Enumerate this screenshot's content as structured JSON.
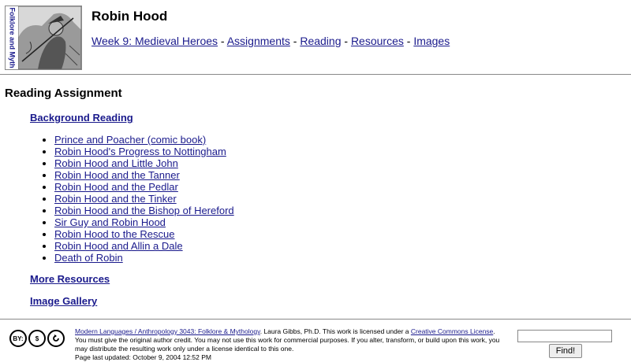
{
  "header": {
    "logo_text": "Folklore and Myth",
    "title": "Robin Hood",
    "nav": [
      {
        "label": "Week 9: Medieval Heroes"
      },
      {
        "label": "Assignments"
      },
      {
        "label": "Reading"
      },
      {
        "label": "Resources"
      },
      {
        "label": "Images"
      }
    ],
    "nav_separator": " - "
  },
  "main": {
    "section_title": "Reading Assignment",
    "background_heading": "Background Reading",
    "readings": [
      "Prince and Poacher (comic book)",
      "Robin Hood's Progress to Nottingham",
      "Robin Hood and Little John",
      "Robin Hood and the Tanner",
      "Robin Hood and the Pedlar",
      "Robin Hood and the Tinker",
      "Robin Hood and the Bishop of Hereford",
      "Sir Guy and Robin Hood",
      "Robin Hood to the Rescue",
      "Robin Hood and Allin a Dale",
      "Death of Robin"
    ],
    "more_resources": "More Resources",
    "image_gallery": "Image Gallery"
  },
  "footer": {
    "badge_labels": [
      "BY:",
      "$",
      "="
    ],
    "course_link": "Modern Languages / Anthropology 3043: Folklore & Mythology",
    "text1": ". Laura Gibbs, Ph.D. This work is licensed under a ",
    "license_link": "Creative Commons License",
    "text2": ". You must give the original author credit. You may not use this work for commercial purposes. If you alter, transform, or build upon this work, you may distribute the resulting work only under a license identical to this one.",
    "updated": "Page last updated: October 9, 2004 12:52 PM",
    "search_value": "",
    "find_label": "Find!"
  },
  "colors": {
    "link": "#1a1a8c",
    "rule": "#888888"
  }
}
